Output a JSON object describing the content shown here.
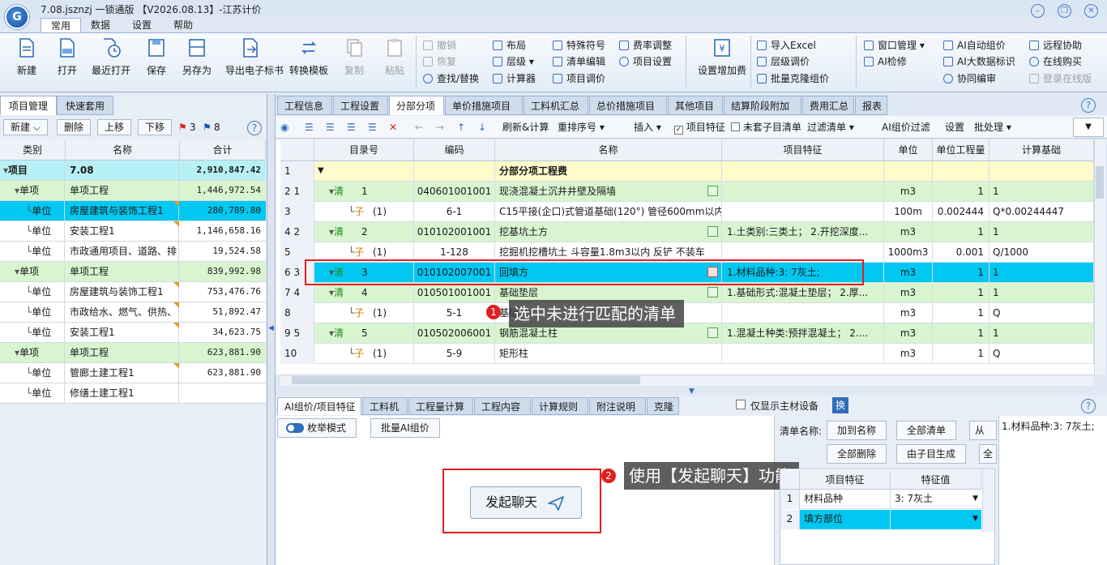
{
  "app": {
    "title": "7.08.jsznzj 一锁通版 【V2026.08.13】-江苏计价",
    "logo_text": "G"
  },
  "menu": [
    "常用",
    "数据",
    "设置",
    "帮助"
  ],
  "ribbon": {
    "big_buttons": [
      "新建",
      "打开",
      "最近打开",
      "保存",
      "另存为",
      "导出电子标书",
      "转换模板",
      "复制",
      "粘贴"
    ],
    "edit_group": [
      "撤销",
      "恢复",
      "查找/替换"
    ],
    "layout_group": [
      "布局",
      "层级",
      "计算器"
    ],
    "special_group": [
      "特殊符号",
      "清单编辑",
      "项目调价"
    ],
    "rate_group": [
      "费率调整",
      "项目设置"
    ],
    "fee_button": "设置增加费",
    "excel_group": [
      "导入Excel",
      "层级调价",
      "批量克隆组价"
    ],
    "window_group": [
      "窗口管理",
      "AI检修"
    ],
    "ai_group": [
      "AI自动组价",
      "AI大数据标识",
      "协同编审"
    ],
    "remote_group": [
      "远程协助",
      "在线购买",
      "登录在线版"
    ]
  },
  "left_panel": {
    "tabs": [
      "项目管理",
      "快速套用"
    ],
    "buttons": [
      "新建",
      "删除",
      "上移",
      "下移"
    ],
    "flag_red_count": "3",
    "flag_blue_count": "8",
    "headers": [
      "类别",
      "名称",
      "合计"
    ],
    "rows": [
      {
        "type": "项目",
        "name": "7.08",
        "total": "2,910,847.42"
      },
      {
        "type": "单项",
        "name": "单项工程",
        "total": "1,446,972.54"
      },
      {
        "type": "单位",
        "name": "房屋建筑与装饰工程1",
        "total": "280,789.80"
      },
      {
        "type": "单位",
        "name": "安装工程1",
        "total": "1,146,658.16"
      },
      {
        "type": "单位",
        "name": "市政通用项目、道路、排",
        "total": "19,524.58"
      },
      {
        "type": "单项",
        "name": "单项工程",
        "total": "839,992.98"
      },
      {
        "type": "单位",
        "name": "房屋建筑与装饰工程1",
        "total": "753,476.76"
      },
      {
        "type": "单位",
        "name": "市政给水、燃气、供热、",
        "total": "51,892.47"
      },
      {
        "type": "单位",
        "name": "安装工程1",
        "total": "34,623.75"
      },
      {
        "type": "单项",
        "name": "单项工程",
        "total": "623,881.90"
      },
      {
        "type": "单位",
        "name": "管廊土建工程1",
        "total": "623,881.90"
      },
      {
        "type": "单位",
        "name": "修缮土建工程1",
        "total": ""
      }
    ]
  },
  "main_tabs": [
    "工程信息",
    "工程设置",
    "分部分项",
    "单价措施项目",
    "工料机汇总",
    "总价措施项目",
    "其他项目",
    "结算阶段附加",
    "费用汇总",
    "报表"
  ],
  "toolbar2": {
    "refresh": "刷新&计算",
    "reorder": "重排序号",
    "insert": "插入",
    "project_feature": "项目特征",
    "unmatched_list": "未套子目清单",
    "filter_list": "过滤清单",
    "ai_filter": "AI组价过滤",
    "settings": "设置",
    "batch": "批处理"
  },
  "grid": {
    "headers": [
      "目录号",
      "编码",
      "名称",
      "项目特征",
      "单位",
      "单位工程量",
      "计算基础"
    ],
    "rows": [
      {
        "row": "1",
        "idx": "",
        "kind": "",
        "dir": "",
        "code": "",
        "name": "分部分项工程费",
        "feature": "",
        "unit": "",
        "qty": "",
        "base": ""
      },
      {
        "row": "2",
        "idx": "1",
        "kind": "清",
        "dir": "1",
        "code": "040601001001",
        "name": "现浇混凝土沉井井壁及隔墙",
        "feature": "",
        "unit": "m3",
        "qty": "1",
        "base": "1"
      },
      {
        "row": "3",
        "idx": "",
        "kind": "子",
        "dir": "(1)",
        "code": "6-1",
        "name": "C15平接(企口)式管道基础(120°) 管径600mm以内",
        "feature": "",
        "unit": "100m",
        "qty": "0.002444",
        "base": "Q*0.00244447"
      },
      {
        "row": "4",
        "idx": "2",
        "kind": "清",
        "dir": "2",
        "code": "010102001001",
        "name": "挖基坑土方",
        "feature": "1.土类别:三类土； 2.开挖深度...",
        "unit": "m3",
        "qty": "1",
        "base": "1"
      },
      {
        "row": "5",
        "idx": "",
        "kind": "子",
        "dir": "(1)",
        "code": "1-128",
        "name": "挖掘机挖槽坑土 斗容量1.8m3以内 反铲 不装车",
        "feature": "",
        "unit": "1000m3",
        "qty": "0.001",
        "base": "Q/1000"
      },
      {
        "row": "6",
        "idx": "3",
        "kind": "清",
        "dir": "3",
        "code": "010102007001",
        "name": "回填方",
        "feature": "1.材料品种:3: 7灰土;",
        "unit": "m3",
        "qty": "1",
        "base": "1"
      },
      {
        "row": "7",
        "idx": "4",
        "kind": "清",
        "dir": "4",
        "code": "010501001001",
        "name": "基础垫层",
        "feature": "1.基础形式:混凝土垫层； 2.厚...",
        "unit": "m3",
        "qty": "1",
        "base": "1"
      },
      {
        "row": "8",
        "idx": "",
        "kind": "子",
        "dir": "(1)",
        "code": "5-1",
        "name": "基础",
        "feature": "",
        "unit": "m3",
        "qty": "1",
        "base": "Q"
      },
      {
        "row": "9",
        "idx": "5",
        "kind": "清",
        "dir": "5",
        "code": "010502006001",
        "name": "钢筋混凝土柱",
        "feature": "1.混凝土种类:预拌混凝土； 2....",
        "unit": "m3",
        "qty": "1",
        "base": "1"
      },
      {
        "row": "10",
        "idx": "",
        "kind": "子",
        "dir": "(1)",
        "code": "5-9",
        "name": "矩形柱",
        "feature": "",
        "unit": "m3",
        "qty": "1",
        "base": "Q"
      }
    ]
  },
  "callouts": {
    "step1_num": "1",
    "step1_text": "选中未进行匹配的清单",
    "step2_num": "2",
    "step2_text": "使用【发起聊天】功能"
  },
  "bottom": {
    "tabs": [
      "AI组价/项目特征",
      "工料机",
      "工程量计算",
      "工程内容",
      "计算规则",
      "附注说明",
      "克隆"
    ],
    "only_main_material": "仅显示主材设备",
    "swap": "换",
    "enum_mode": "枚举模式",
    "batch_ai": "批量AI组价",
    "start_chat": "发起聊天",
    "list_name_label": "清单名称:",
    "btn_add_name": "加到名称",
    "btn_all_list": "全部清单",
    "btn_from": "从",
    "btn_delete_all": "全部删除",
    "btn_from_sub": "由子目生成",
    "btn_all2": "全",
    "feature_headers": [
      "项目特征",
      "特征值"
    ],
    "features": [
      {
        "no": "1",
        "name": "材料品种",
        "value": "3: 7灰土"
      },
      {
        "no": "2",
        "name": "填方部位",
        "value": ""
      }
    ],
    "preview_text": "1.材料品种:3: 7灰土;"
  },
  "colors": {
    "accent": "#1a62b5",
    "selected_row": "#00c8f0",
    "green_row": "#d8f5d0",
    "yellow_row": "#fffbcc",
    "highlight_red": "#e02020"
  }
}
